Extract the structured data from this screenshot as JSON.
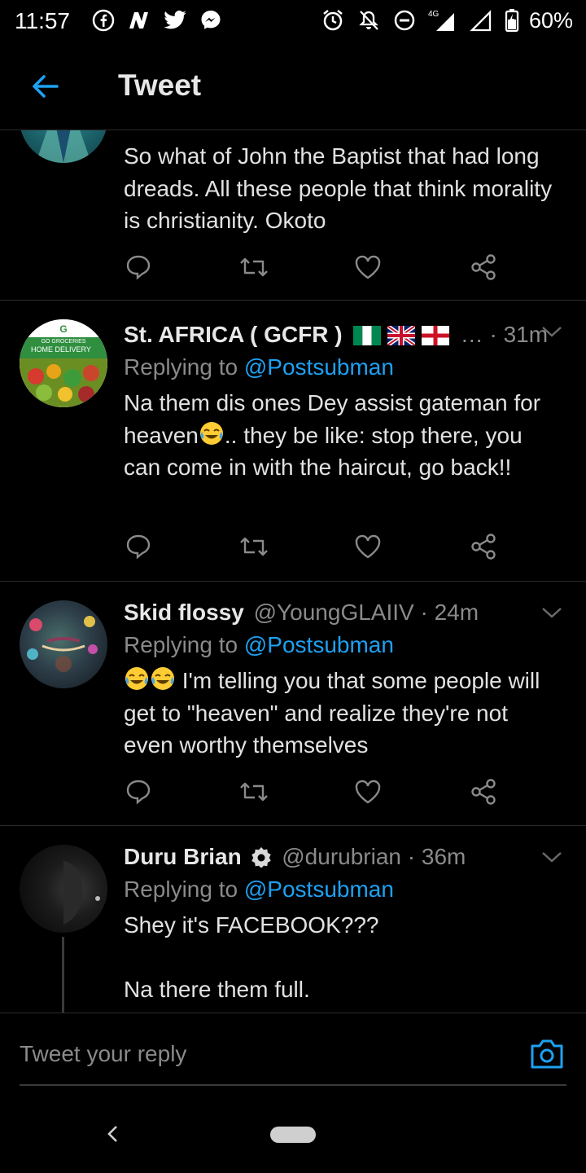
{
  "status_bar": {
    "time": "11:57",
    "battery": "60%",
    "network": "4G",
    "left_icons": [
      "facebook-icon",
      "news-icon",
      "twitter-icon",
      "messenger-icon"
    ],
    "right_icons": [
      "alarm-icon",
      "mute-icon",
      "dnd-icon",
      "signal-icon",
      "battery-icon"
    ]
  },
  "header": {
    "title": "Tweet"
  },
  "tweets": [
    {
      "text": "So what of John the Baptist that had long dreads. All these people that think morality is christianity. Okoto"
    },
    {
      "name": "St. AFRICA ( GCFR )",
      "handle": "…",
      "time": "· 31m",
      "replying_prefix": "Replying to",
      "mention": "@Postsubman",
      "text_a": "Na them dis ones Dey assist gateman for heaven",
      "text_b": "..  they be like: stop there, you can come in with the haircut, go back!!",
      "avatar_label": "HOME DELIVERY",
      "avatar_brand": "GO GROCERIES"
    },
    {
      "name": "Skid flossy",
      "handle": "@YoungGLAIIV",
      "time": "· 24m",
      "replying_prefix": "Replying to",
      "mention": "@Postsubman",
      "text": " I'm telling you that some people will get to \"heaven\" and realize they're not even worthy themselves"
    },
    {
      "name": "Duru Brian",
      "handle": "@durubrian",
      "time": "· 36m",
      "replying_prefix": "Replying to",
      "mention": "@Postsubman",
      "text_a": "Shey it's FACEBOOK???",
      "text_b": "Na there them full."
    }
  ],
  "reply_bar": {
    "placeholder": "Tweet your reply"
  },
  "colors": {
    "accent": "#1da1f2",
    "background": "#000000",
    "muted": "#8a8a8a",
    "divider": "#2b2b2b"
  }
}
